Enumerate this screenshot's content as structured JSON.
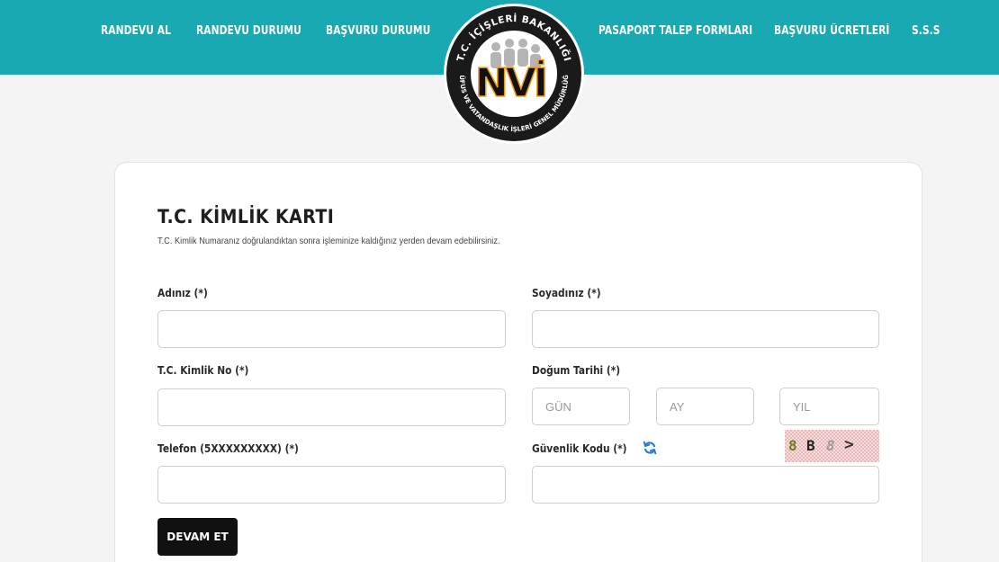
{
  "nav": {
    "left": [
      "RANDEVU AL",
      "RANDEVU DURUMU",
      "BAŞVURU DURUMU"
    ],
    "right": [
      "PASAPORT TALEP FORMLARI",
      "BAŞVURU ÜCRETLERİ",
      "S.S.S"
    ]
  },
  "logo": {
    "top_text": "T.C. İÇİŞLERİ BAKANLIĞI",
    "bottom_text": "NÜFUS VE VATANDAŞLIK İŞLERİ GENEL MÜDÜRLÜĞÜ",
    "mark": "NVİ"
  },
  "form": {
    "title": "T.C. KİMLİK KARTI",
    "subtitle": "T.C. Kimlik Numaranız doğrulandıktan sonra işleminize kaldığınız yerden devam edebilirsiniz.",
    "first_name_label": "Adınız (*)",
    "last_name_label": "Soyadınız (*)",
    "tc_label": "T.C. Kimlik No (*)",
    "birth_label": "Doğum Tarihi (*)",
    "day_placeholder": "GÜN",
    "month_placeholder": "AY",
    "year_placeholder": "YIL",
    "phone_label": "Telefon (5XXXXXXXXX) (*)",
    "security_label": "Güvenlik Kodu (*)",
    "captcha": [
      "8",
      "B",
      "8",
      ">"
    ],
    "submit_label": "DEVAM ET"
  },
  "colors": {
    "header": "#19a9b2",
    "logo_orange": "#f39c12",
    "refresh": "#2a7bd5",
    "button": "#111111"
  }
}
